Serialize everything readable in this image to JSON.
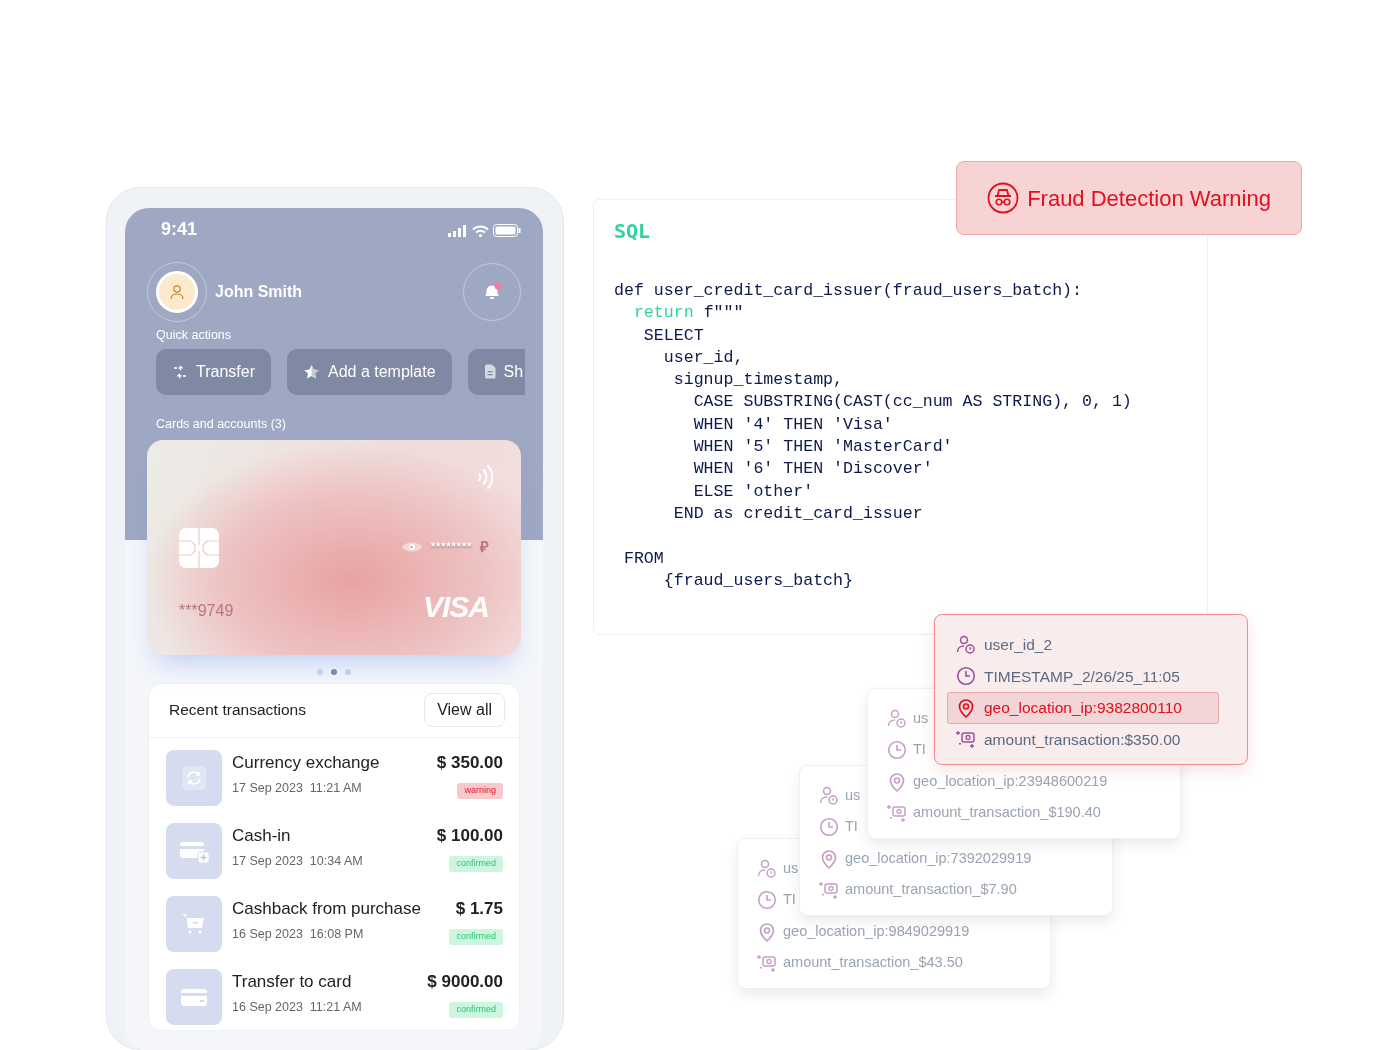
{
  "phone": {
    "status_bar": {
      "time": "9:41"
    },
    "user": {
      "name": "John Smith",
      "notification": true
    },
    "quick_actions": {
      "label": "Quick actions",
      "buttons": [
        {
          "label": "Transfer",
          "kind": "transfer"
        },
        {
          "label": "Add a template",
          "kind": "star"
        },
        {
          "label": "Sh",
          "kind": "document"
        }
      ]
    },
    "cards": {
      "label": "Cards and accounts (3)",
      "balance_mask": "********",
      "currency": "₽",
      "number": "***9749",
      "brand": "VISA",
      "pages": [
        {
          "selected": false
        },
        {
          "selected": true
        },
        {
          "selected": false
        }
      ]
    },
    "transactions": {
      "title": "Recent transactions",
      "view_all": "View all",
      "rows": [
        {
          "kind": "exchange",
          "title": "Currency exchange",
          "date": "17 Sep 2023  11:21 AM",
          "amount": "$ 350.00",
          "status": "warning"
        },
        {
          "kind": "cash-in",
          "title": "Cash-in",
          "date": "17 Sep 2023  10:34 AM",
          "amount": "$ 100.00",
          "status": "confirmed"
        },
        {
          "kind": "cart",
          "title": "Cashback from purchase",
          "date": "16 Sep 2023  16:08 PM",
          "amount": "$ 1.75",
          "status": "confirmed"
        },
        {
          "kind": "card",
          "title": "Transfer to card",
          "date": "16 Sep 2023  11:21 AM",
          "amount": "$ 9000.00",
          "status": "confirmed"
        }
      ]
    }
  },
  "code_panel": {
    "language": "SQL",
    "lines": [
      {
        "segments": [
          {
            "text": "def user_credit_card_issuer(fraud_users_batch):"
          }
        ]
      },
      {
        "segments": [
          {
            "text": "  return",
            "kind": "keyword"
          },
          {
            "text": " f\"\"\""
          }
        ]
      },
      {
        "segments": [
          {
            "text": "   SELECT"
          }
        ]
      },
      {
        "segments": [
          {
            "text": "     user_id,"
          }
        ]
      },
      {
        "segments": [
          {
            "text": "      signup_timestamp,"
          }
        ]
      },
      {
        "segments": [
          {
            "text": "        CASE SUBSTRING(CAST(cc_num AS STRING), 0, 1)"
          }
        ]
      },
      {
        "segments": [
          {
            "text": "        WHEN '4' THEN 'Visa'"
          }
        ]
      },
      {
        "segments": [
          {
            "text": "        WHEN '5' THEN 'MasterCard'"
          }
        ]
      },
      {
        "segments": [
          {
            "text": "        WHEN '6' THEN 'Discover'"
          }
        ]
      },
      {
        "segments": [
          {
            "text": "        ELSE 'other'"
          }
        ]
      },
      {
        "segments": [
          {
            "text": "      END as credit_card_issuer"
          }
        ]
      },
      {
        "blank_before": true,
        "segments": [
          {
            "text": " FROM"
          }
        ]
      },
      {
        "segments": [
          {
            "text": "     {fraud_users_batch}"
          }
        ]
      }
    ]
  },
  "warning_banner": {
    "text": "Fraud Detection Warning"
  },
  "records": [
    {
      "alert": true,
      "rows": [
        {
          "kind": "user",
          "text": "user_id_2",
          "flagged": false
        },
        {
          "kind": "time",
          "text": "TIMESTAMP_2/26/25_11:05",
          "flagged": false
        },
        {
          "kind": "location",
          "text": "geo_location_ip:9382800110",
          "flagged": true
        },
        {
          "kind": "amount",
          "text": "amount_transaction:$350.00",
          "flagged": false
        }
      ]
    },
    {
      "alert": false,
      "rows": [
        {
          "kind": "user",
          "text": "us",
          "flagged": false
        },
        {
          "kind": "time",
          "text": "TI",
          "flagged": false
        },
        {
          "kind": "location",
          "text": "geo_location_ip:23948600219",
          "flagged": false
        },
        {
          "kind": "amount",
          "text": "amount_transaction_$190.40",
          "flagged": false
        }
      ]
    },
    {
      "alert": false,
      "rows": [
        {
          "kind": "user",
          "text": "us",
          "flagged": false
        },
        {
          "kind": "time",
          "text": "TI",
          "flagged": false
        },
        {
          "kind": "location",
          "text": "geo_location_ip:7392029919",
          "flagged": false
        },
        {
          "kind": "amount",
          "text": "amount_transaction_$7.90",
          "flagged": false
        }
      ]
    },
    {
      "alert": false,
      "rows": [
        {
          "kind": "user",
          "text": "us",
          "flagged": false
        },
        {
          "kind": "time",
          "text": "TI",
          "flagged": false
        },
        {
          "kind": "location",
          "text": "geo_location_ip:9849029919",
          "flagged": false
        },
        {
          "kind": "amount",
          "text": "amount_transaction_$43.50",
          "flagged": false
        }
      ]
    }
  ]
}
